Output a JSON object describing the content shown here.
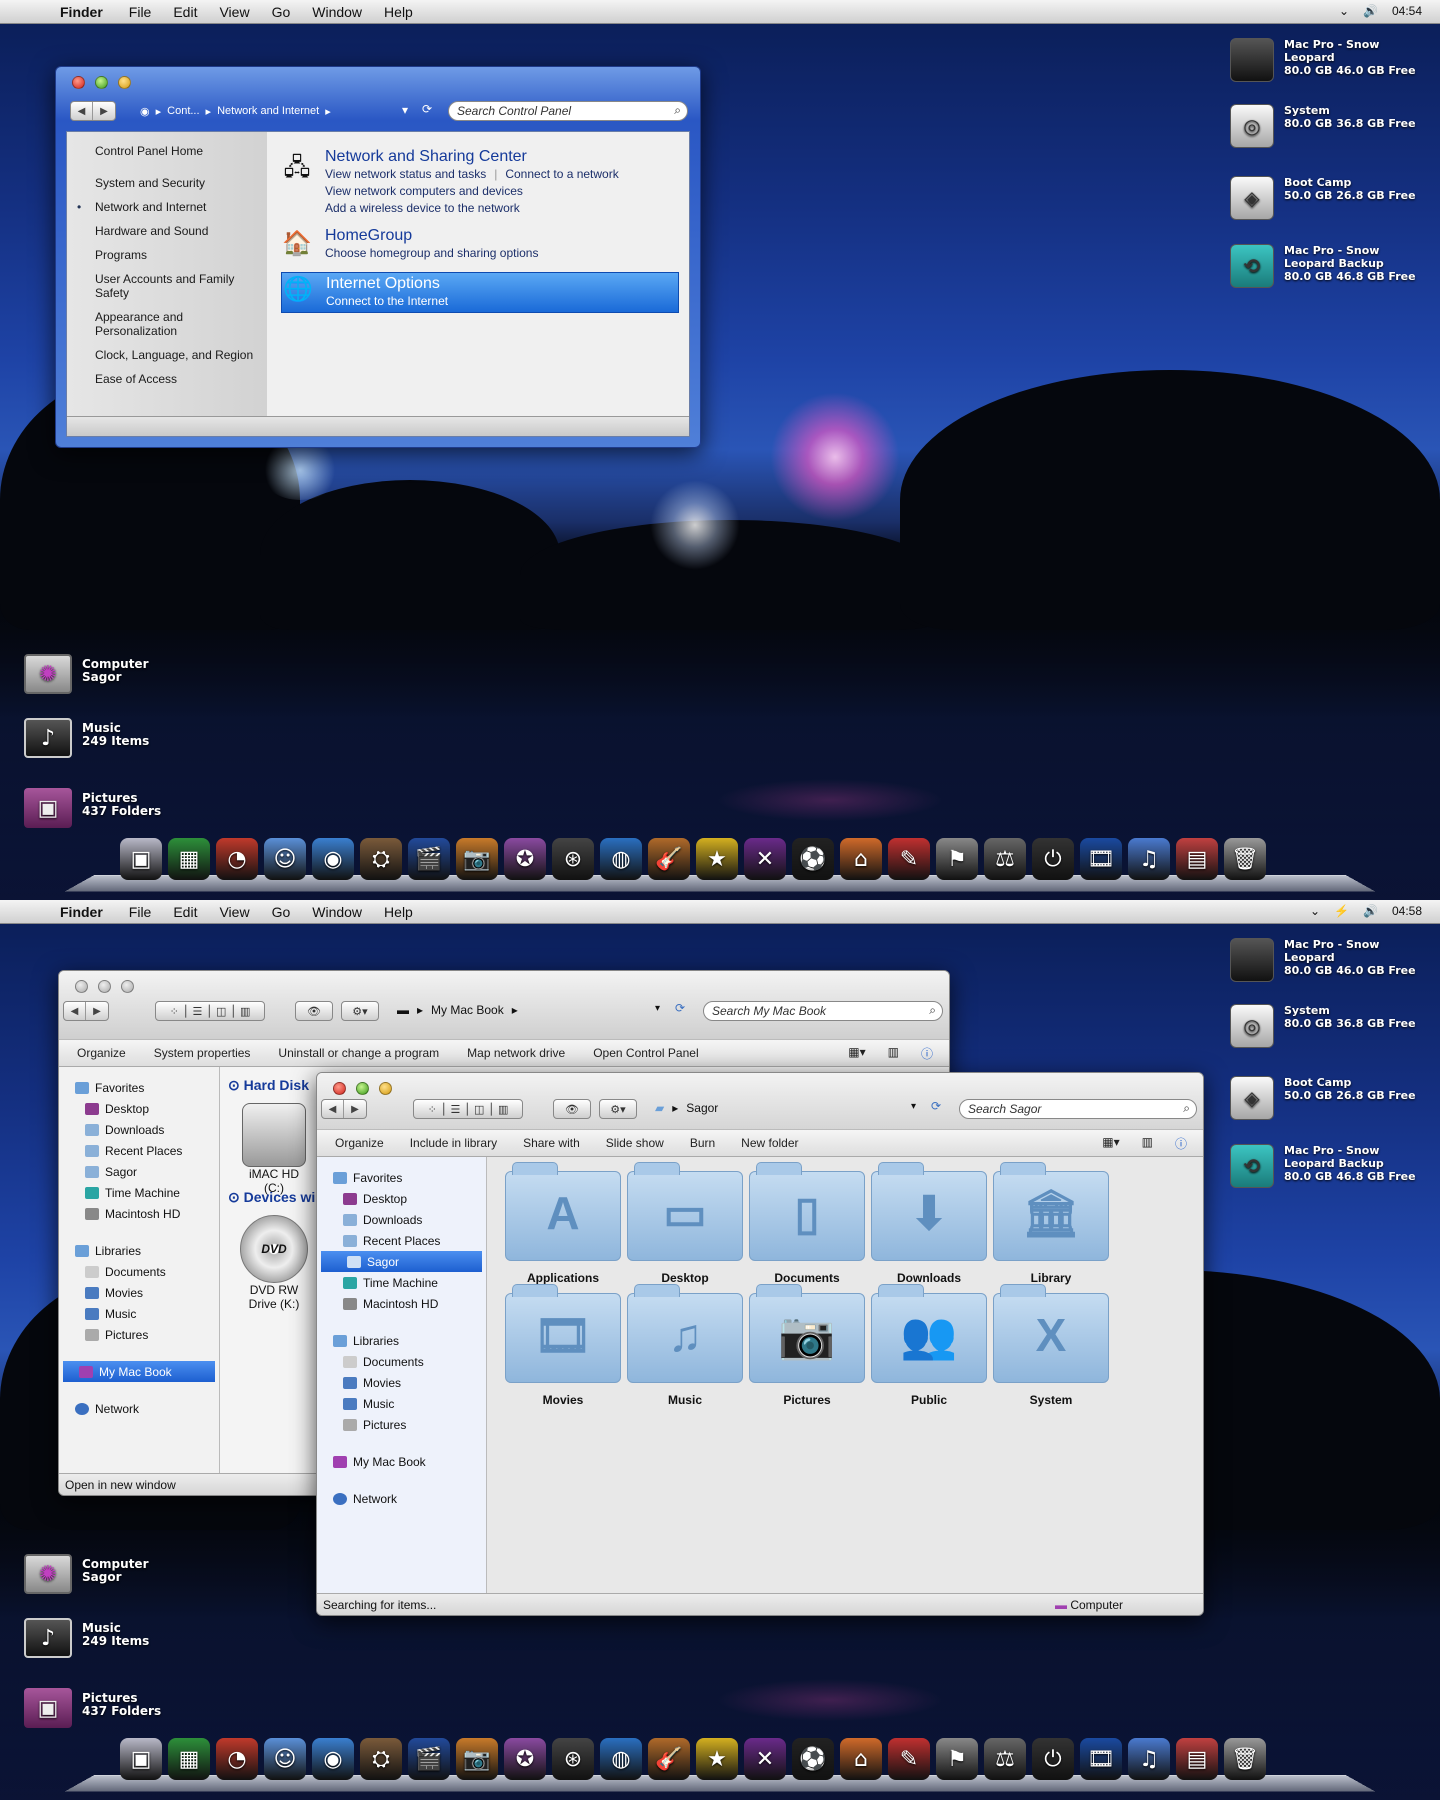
{
  "screen1": {
    "menubar": {
      "app": "Finder",
      "items": [
        "File",
        "Edit",
        "View",
        "Go",
        "Window",
        "Help"
      ],
      "clock": "04:54"
    },
    "control_panel": {
      "breadcrumb": [
        "Cont...",
        "Network and Internet"
      ],
      "search_placeholder": "Search Control Panel",
      "nav": {
        "home": "Control Panel Home",
        "items": [
          "System and Security",
          "Network and Internet",
          "Hardware and Sound",
          "Programs",
          "User Accounts and Family Safety",
          "Appearance and Personalization",
          "Clock, Language, and Region",
          "Ease of Access"
        ],
        "current": "Network and Internet"
      },
      "sections": [
        {
          "title": "Network and Sharing Center",
          "links": [
            "View network status and tasks",
            "Connect to a network",
            "View network computers and devices",
            "Add a wireless device to the network"
          ]
        },
        {
          "title": "HomeGroup",
          "links": [
            "Choose homegroup and sharing options"
          ]
        },
        {
          "title": "Internet Options",
          "links": [
            "Connect to the Internet"
          ]
        }
      ]
    }
  },
  "screen2": {
    "menubar": {
      "app": "Finder",
      "items": [
        "File",
        "Edit",
        "View",
        "Go",
        "Window",
        "Help"
      ],
      "clock": "04:58"
    },
    "back_window": {
      "location": "My Mac Book",
      "search_placeholder": "Search My Mac Book",
      "commands": [
        "Organize",
        "System properties",
        "Uninstall or change a program",
        "Map network drive",
        "Open Control Panel"
      ],
      "nav": {
        "favorites": "Favorites",
        "favorite_items": [
          "Desktop",
          "Downloads",
          "Recent Places",
          "Sagor",
          "Time Machine",
          "Macintosh HD"
        ],
        "libraries": "Libraries",
        "library_items": [
          "Documents",
          "Movies",
          "Music",
          "Pictures"
        ],
        "computer": "My Mac Book",
        "network": "Network"
      },
      "groups": [
        "Hard Disk",
        "Devices wi"
      ],
      "drives": [
        {
          "label": "iMAC HD",
          "sub": "(C:)"
        },
        {
          "label": "DVD RW",
          "sub": "Drive (K:)"
        }
      ],
      "dvd_badge": "DVD",
      "status": "Open in new window"
    },
    "front_window": {
      "location": "Sagor",
      "search_placeholder": "Search Sagor",
      "commands": [
        "Organize",
        "Include in library",
        "Share with",
        "Slide show",
        "Burn",
        "New folder"
      ],
      "nav": {
        "favorites": "Favorites",
        "favorite_items": [
          "Desktop",
          "Downloads",
          "Recent Places",
          "Sagor",
          "Time Machine",
          "Macintosh HD"
        ],
        "selected": "Sagor",
        "libraries": "Libraries",
        "library_items": [
          "Documents",
          "Movies",
          "Music",
          "Pictures"
        ],
        "computer": "My Mac Book",
        "network": "Network"
      },
      "folders": [
        {
          "name": "Applications",
          "icon": "A"
        },
        {
          "name": "Desktop",
          "icon": "▭"
        },
        {
          "name": "Documents",
          "icon": "▯"
        },
        {
          "name": "Downloads",
          "icon": "⬇"
        },
        {
          "name": "Library",
          "icon": "🏛"
        },
        {
          "name": "Movies",
          "icon": "🎞"
        },
        {
          "name": "Music",
          "icon": "♫"
        },
        {
          "name": "Pictures",
          "icon": "📷"
        },
        {
          "name": "Public",
          "icon": "👥"
        },
        {
          "name": "System",
          "icon": "X"
        }
      ],
      "status": "Searching for items...",
      "status_right": "Computer"
    }
  },
  "drives": [
    {
      "name": "Mac Pro - Snow Leopard",
      "size": "80.0 GB 46.0 GB Free",
      "icon": "apple-drive-icon"
    },
    {
      "name": "System",
      "size": "80.0 GB 36.8 GB Free",
      "icon": "hard-disk-icon"
    },
    {
      "name": "Boot Camp",
      "size": "50.0 GB 26.8 GB Free",
      "icon": "bootcamp-drive-icon"
    },
    {
      "name": "Mac Pro - Snow Leopard Backup",
      "size": "80.0 GB 46.8 GB Free",
      "icon": "time-machine-drive-icon"
    }
  ],
  "desktop_items": [
    {
      "name": "Computer",
      "sub": "Sagor",
      "icon": "computer-icon"
    },
    {
      "name": "Music",
      "sub": "249 Items",
      "icon": "music-icon"
    },
    {
      "name": "Pictures",
      "sub": "437 Folders",
      "icon": "pictures-folder-icon"
    }
  ],
  "dock": [
    "imac",
    "photo",
    "dashboard",
    "finder",
    "itunes-disc",
    "preview",
    "imovie",
    "iphoto",
    "safari-like",
    "audio",
    "firefox",
    "garageband",
    "star",
    "x",
    "soccer",
    "home",
    "paint",
    "hanger",
    "scale",
    "power",
    "movie-strip",
    "music-notes",
    "docs",
    "trash"
  ],
  "colors": {
    "accent": "#1a6ad8",
    "link": "#153a9a"
  }
}
